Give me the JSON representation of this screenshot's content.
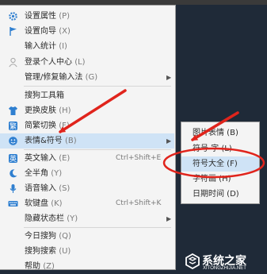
{
  "menu": {
    "items": [
      {
        "label": "设置属性",
        "key": "(P)",
        "icon": "gear-icon"
      },
      {
        "label": "设置向导",
        "key": "(X)",
        "icon": "flag-icon"
      },
      {
        "label": "输入统计",
        "key": "(I)",
        "icon": ""
      },
      {
        "label": "登录个人中心",
        "key": "(L)",
        "icon": "user-icon"
      },
      {
        "label": "管理/修复输入法",
        "key": "(G)",
        "icon": ""
      },
      {
        "label": "搜狗工具箱",
        "key": "",
        "icon": ""
      },
      {
        "label": "更换皮肤",
        "key": "(H)",
        "icon": "shirt-icon"
      },
      {
        "label": "简繁切换",
        "key": "(F)",
        "icon": "traditional-icon"
      },
      {
        "label": "表情&符号",
        "key": "(B)",
        "icon": "smiley-icon"
      },
      {
        "label": "英文输入",
        "key": "(E)",
        "icon": "english-icon",
        "shortcut": "Ctrl+Shift+E"
      },
      {
        "label": "全半角",
        "key": "(Y)",
        "icon": "moon-icon"
      },
      {
        "label": "语音输入",
        "key": "(S)",
        "icon": "mic-icon"
      },
      {
        "label": "软键盘",
        "key": "(K)",
        "icon": "keyboard-icon",
        "shortcut": "Ctrl+Shift+K"
      },
      {
        "label": "隐藏状态栏",
        "key": "(Y)",
        "icon": ""
      },
      {
        "label": "今日搜狗",
        "key": "(Q)",
        "icon": ""
      },
      {
        "label": "搜狗搜索",
        "key": "(U)",
        "icon": ""
      },
      {
        "label": "帮助",
        "key": "(Z)",
        "icon": ""
      }
    ]
  },
  "submenu": {
    "items": [
      {
        "label": "图片表情 (B)"
      },
      {
        "label": "符号 字 (L)"
      },
      {
        "label": "符号大全 (F)"
      },
      {
        "label": "字符画 (H)"
      },
      {
        "label": "日期时间 (D)"
      }
    ]
  },
  "watermark": {
    "brand": "系统之家",
    "url": "XITONGZHIJIA.NET"
  },
  "colors": {
    "highlight": "#cfe3f6",
    "annotation": "#e0241c",
    "icon_blue": "#2f7fd0"
  }
}
